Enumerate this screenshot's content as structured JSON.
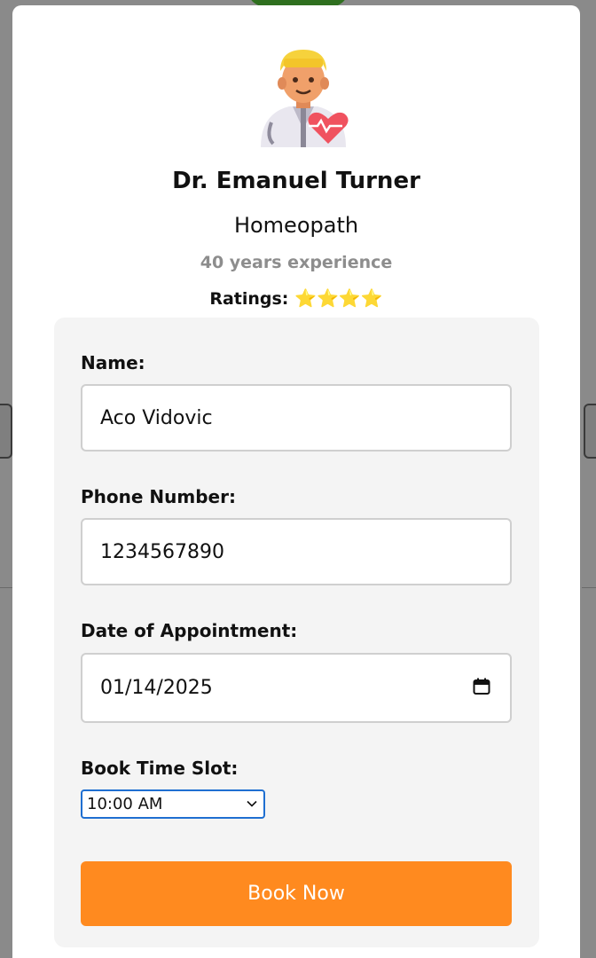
{
  "doctor": {
    "name": "Dr. Emanuel Turner",
    "speciality": "Homeopath",
    "experience": "40 years experience",
    "ratings_label": "Ratings:",
    "stars": "⭐⭐⭐⭐",
    "rating_count": 4,
    "avatar_icon": "doctor-avatar-icon"
  },
  "form": {
    "name_label": "Name:",
    "name_value": "Aco Vidovic",
    "phone_label": "Phone Number:",
    "phone_value": "1234567890",
    "date_label": "Date of Appointment:",
    "date_value": "01/14/2025",
    "time_label": "Book Time Slot:",
    "time_value": "10:00 AM",
    "book_button": "Book Now"
  },
  "colors": {
    "accent": "#ff8a1f",
    "panel": "#f4f4f4",
    "select_border": "#1f6fd1"
  }
}
